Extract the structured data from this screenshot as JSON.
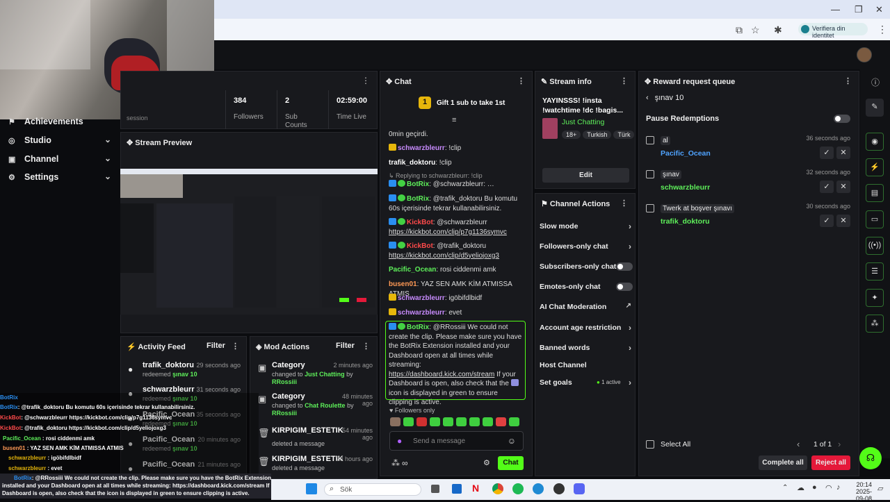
{
  "browser": {
    "identity_label": "Verifiera din identitet",
    "win_minimize": "—",
    "win_maximize": "❐",
    "win_close": "✕"
  },
  "nav": {
    "items": [
      {
        "label": "Achievements",
        "icon": "trophy-icon"
      },
      {
        "label": "Studio",
        "icon": "studio-icon",
        "chevron": "⌄"
      },
      {
        "label": "Channel",
        "icon": "channel-icon",
        "chevron": "⌄"
      },
      {
        "label": "Settings",
        "icon": "gear-icon",
        "chevron": "⌄"
      }
    ],
    "session_fragment": "session"
  },
  "stats": [
    {
      "value": "384",
      "label": "Followers"
    },
    {
      "value": "2",
      "label": "Sub Counts"
    },
    {
      "value": "02:59:00",
      "label": "Time Live"
    }
  ],
  "panels": {
    "stream_preview": "Stream Preview",
    "activity_feed": "Activity Feed",
    "activity_filter": "Filter",
    "mod_actions": "Mod Actions",
    "mod_filter": "Filter",
    "chat": "Chat",
    "stream_info": "Stream info",
    "channel_actions": "Channel Actions",
    "reward_queue": "Reward request queue"
  },
  "activity": [
    {
      "name": "trafik_doktoru",
      "time": "29 seconds ago",
      "action": "redeemed",
      "reward": "şınav 10"
    },
    {
      "name": "schwarzbleurr",
      "time": "31 seconds ago",
      "action": "redeemed",
      "reward": "şınav 10"
    },
    {
      "name": "Pacific_Ocean",
      "time": "35 seconds ago",
      "action": "redeemed",
      "reward": "şınav 10"
    },
    {
      "name": "Pacific_Ocean",
      "time": "20 minutes ago",
      "action": "redeemed",
      "reward": "şınav 10"
    },
    {
      "name": "Pacific_Ocean",
      "time": "21 minutes ago",
      "action": "redeemed",
      "reward": ""
    }
  ],
  "mod_actions": [
    {
      "title": "Category",
      "time": "2 minutes ago",
      "line1": "changed to",
      "value": "Just Chatting",
      "line2": "by",
      "by": "RRossiii"
    },
    {
      "title": "Category",
      "time": "48 minutes ago",
      "line1": "changed to",
      "value": "Chat Roulette",
      "line2": "by",
      "by": "RRossiii"
    },
    {
      "title": "KIRPIGIM_ESTETIK",
      "time": "54 minutes ago",
      "line1": "deleted a message",
      "value": "",
      "line2": "",
      "by": ""
    },
    {
      "title": "KIRPIGIM_ESTETIK",
      "time": "20 hours ago",
      "line1": "deleted a message",
      "value": "",
      "line2": "",
      "by": ""
    }
  ],
  "chat": {
    "gift_badge": "1",
    "gift_text": "Gift 1 sub to take 1st",
    "top_fragment": "0min geçirdi.",
    "messages": [
      {
        "user": "schwarzbleurr",
        "color": "#c98cff",
        "text": "!clip"
      },
      {
        "user": "trafik_doktoru",
        "color": "#ffffff",
        "text": "!clip"
      },
      {
        "reply": "Replying to schwarzbleurr: !clip",
        "user": "BotRix",
        "color": "#5ef05a",
        "text": "@schwarzbleurr: …"
      },
      {
        "user": "BotRix",
        "color": "#5ef05a",
        "text": "@trafik_doktoru Bu komutu 60s içerisinde tekrar kullanabilirsiniz."
      },
      {
        "user": "KickBot",
        "color": "#ff4a4a",
        "text": "@schwarzbleurr",
        "link": "https://kickbot.com/clip/p7g1136symvc"
      },
      {
        "user": "KickBot",
        "color": "#ff4a4a",
        "text": "@trafik_doktoru",
        "link": "https://kickbot.com/clip/d5yeliojoxg3"
      },
      {
        "user": "Pacific_Ocean",
        "color": "#5ef05a",
        "text": "rosi ciddenmi amk"
      },
      {
        "user": "busen01",
        "color": "#ff9955",
        "text": "YAZ SEN AMK KİM ATMISSA ATMIS"
      },
      {
        "user": "schwarzbleurr",
        "color": "#c98cff",
        "text": "igöbifdlbidf"
      },
      {
        "user": "schwarzbleurr",
        "color": "#c98cff",
        "text": "evet"
      }
    ],
    "highlight": {
      "user": "BotRix",
      "text1": "@RRossiii We could not create the clip. Please make sure you have the BotRix Extension installed and your Dashboard open at all times while streaming:",
      "link": "https://dashboard.kick.com/stream",
      "text2": "If your Dashboard is open, also check that the",
      "text3": "icon is displayed in green to ensure clipping is active."
    },
    "followers_only": "Followers only",
    "placeholder": "Send a message",
    "send_label": "Chat"
  },
  "stream_info": {
    "title": "YAYINSSS! !insta !watchtime !dc !bagis...",
    "category": "Just Chatting",
    "tags": [
      "18+",
      "Turkish",
      "Türk"
    ],
    "edit_label": "Edit"
  },
  "channel_actions": {
    "items": [
      {
        "label": "Slow mode",
        "kind": "chevron"
      },
      {
        "label": "Followers-only chat",
        "kind": "chevron"
      },
      {
        "label": "Subscribers-only chat",
        "kind": "toggle"
      },
      {
        "label": "Emotes-only chat",
        "kind": "toggle"
      },
      {
        "label": "AI Chat Moderation",
        "kind": "external"
      },
      {
        "label": "Account age restriction",
        "kind": "chevron"
      },
      {
        "label": "Banned words",
        "kind": "chevron"
      },
      {
        "label": "Host Channel",
        "kind": "none"
      },
      {
        "label": "Set goals",
        "kind": "chevron",
        "badge": "1 active"
      }
    ]
  },
  "reward_queue": {
    "back_label": "şınav 10",
    "pause_label": "Pause Redemptions",
    "items": [
      {
        "reward": "al",
        "time": "36 seconds ago",
        "user": "Pacific_Ocean",
        "color": "#4fa3ff"
      },
      {
        "reward": "şınav",
        "time": "32 seconds ago",
        "user": "schwarzbleurr",
        "color": "#5ef05a"
      },
      {
        "reward": "Twerk at boşver şınavı",
        "time": "30 seconds ago",
        "user": "trafik_doktoru",
        "color": "#5ef05a"
      }
    ],
    "select_all": "Select All",
    "pagination": "1 of 1",
    "complete_all": "Complete all",
    "reject_all": "Reject all"
  },
  "overlay_chat": [
    {
      "user": "BotRix",
      "cls": "bn",
      "text": ""
    },
    {
      "user": "BotRix",
      "cls": "bn",
      "text": ": @trafik_doktoru Bu komutu 60s içerisinde tekrar kullanabilirsiniz."
    },
    {
      "user": "KickBot",
      "cls": "kr",
      "text": ": @schwarzbleurr https://kickbot.com/clip/p7g1136symvc"
    },
    {
      "user": "KickBot",
      "cls": "kr",
      "text": ": @trafik_doktoru https://kickbot.com/clip/d5yeliojoxg3"
    },
    {
      "user": "Pacific_Ocean",
      "cls": "pc",
      "text": " : rosi ciddenmi amk"
    },
    {
      "user": "busen01",
      "cls": "bs",
      "text": " : YAZ SEN AMK KİM ATMISSA ATMIS"
    },
    {
      "user": "schwarzbleurr",
      "cls": "sw",
      "text": " : igöbifdlbidf"
    },
    {
      "user": "schwarzbleurr",
      "cls": "sw",
      "text": " : evet"
    },
    {
      "user": "BotRix",
      "cls": "bn",
      "text": ": @RRossiii We could not create the clip. Please make sure you have the BotRix Extension"
    },
    {
      "user": "",
      "cls": "bn",
      "text": "installed and your Dashboard open at all times while streaming: https://dashboard.kick.com/stream If your"
    },
    {
      "user": "",
      "cls": "bn",
      "text": "Dashboard is open, also check that the     icon is displayed in green to ensure clipping is active."
    }
  ],
  "taskbar": {
    "search": "Sök",
    "time": "20:14",
    "date": "2025-09-08"
  },
  "colors": {
    "accent": "#53fc18",
    "panel": "#18191d",
    "reject": "#e5193a"
  }
}
